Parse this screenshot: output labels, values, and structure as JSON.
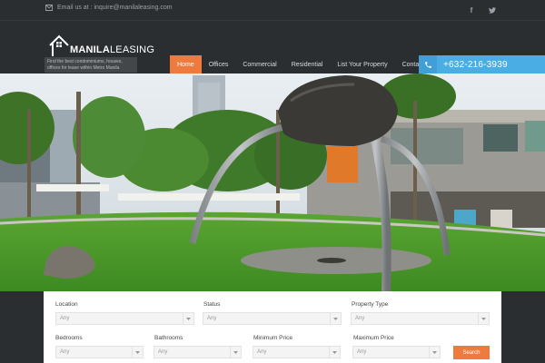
{
  "topbar": {
    "email_text": "Email us at : inquire@manilaleasing.com",
    "social": [
      {
        "icon": "facebook-icon",
        "glyph": "f"
      },
      {
        "icon": "twitter-icon"
      }
    ]
  },
  "brand": {
    "name_bold": "MANILA",
    "name_light": "LEASING",
    "tagline": "Find the best condominiums, houses, offices for lease within Metro Manila"
  },
  "nav": {
    "items": [
      {
        "label": "Home",
        "active": true
      },
      {
        "label": "Offices",
        "active": false
      },
      {
        "label": "Commercial",
        "active": false
      },
      {
        "label": "Residential",
        "active": false
      },
      {
        "label": "List Your Property",
        "active": false
      },
      {
        "label": "Contact us",
        "active": false
      }
    ],
    "phone": "+632-216-3939"
  },
  "search": {
    "location": {
      "label": "Location",
      "value": "Any"
    },
    "status": {
      "label": "Status",
      "value": "Any"
    },
    "property_type": {
      "label": "Property Type",
      "value": "Any"
    },
    "bedrooms": {
      "label": "Bedrooms",
      "value": "Any"
    },
    "bathrooms": {
      "label": "Bathrooms",
      "value": "Any"
    },
    "min_price": {
      "label": "Minimum Price",
      "value": "Any"
    },
    "max_price": {
      "label": "Maximum Price",
      "value": "Any"
    },
    "button_label": "Search"
  },
  "colors": {
    "accent_orange": "#ef7a3d",
    "accent_blue": "#4aaee5",
    "header_bg": "#2b2e31"
  }
}
